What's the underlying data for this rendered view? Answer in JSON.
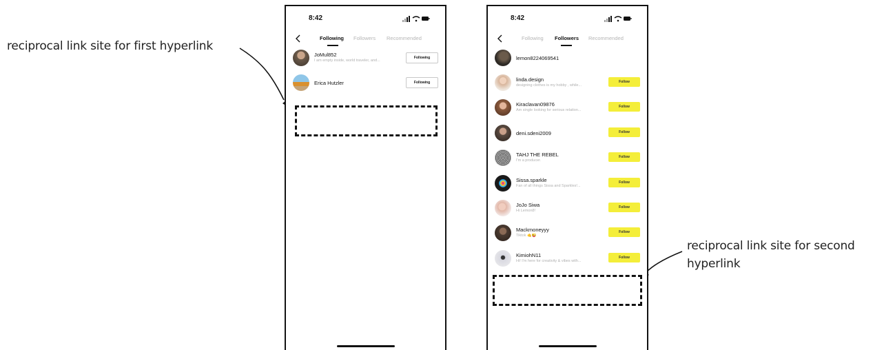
{
  "annotations": {
    "first": "reciprocal link site for first hyperlink",
    "second": "reciprocal link site for second hyperlink"
  },
  "phones": {
    "left": {
      "time": "8:42",
      "tabs": [
        "Following",
        "Followers",
        "Recommended"
      ],
      "active_tab": "Following",
      "rows": [
        {
          "name": "JoMul852",
          "bio": "I am empty inside, world traveler, and...",
          "button": "Following",
          "avatar": "#6b5a4a"
        },
        {
          "name": "Erica Hutzler",
          "bio": "",
          "button": "Following",
          "avatar": "#d9902f"
        }
      ]
    },
    "right": {
      "time": "8:42",
      "tabs": [
        "Following",
        "Followers",
        "Recommended"
      ],
      "active_tab": "Followers",
      "rows": [
        {
          "name": "lemon8224069541",
          "bio": "",
          "button": "",
          "avatar": "#2e2a26"
        },
        {
          "name": "linda.design",
          "bio": "designing clothes is my hobby , while...",
          "button": "Follow",
          "avatar": "#d8b49a"
        },
        {
          "name": "Kiraclavan09876",
          "bio": "Am single looking for serious relation...",
          "button": "Follow",
          "avatar": "#8b5a3c"
        },
        {
          "name": "deni.sdeni2009",
          "bio": "",
          "button": "Follow",
          "avatar": "#5a4a40"
        },
        {
          "name": "TAHJ THE REBEL",
          "bio": "I'm a producer.",
          "button": "Follow",
          "avatar": "#777777"
        },
        {
          "name": "Sissa.sparkle",
          "bio": "Fan of all things Sissa and Sparkles!...",
          "button": "Follow",
          "avatar": "#1a1a1a"
        },
        {
          "name": "JoJo Siwa",
          "bio": "Hi Lemon8!",
          "button": "Follow",
          "avatar": "#e2b7a8"
        },
        {
          "name": "Mackmoneyyy",
          "bio": "Tiktok 🤙😜",
          "button": "Follow",
          "avatar": "#4a3a30"
        },
        {
          "name": "KimiohN11",
          "bio": "Hi! I'm here for creativity & vibes with...",
          "button": "Follow",
          "avatar": "#d8d8e0"
        }
      ]
    }
  }
}
